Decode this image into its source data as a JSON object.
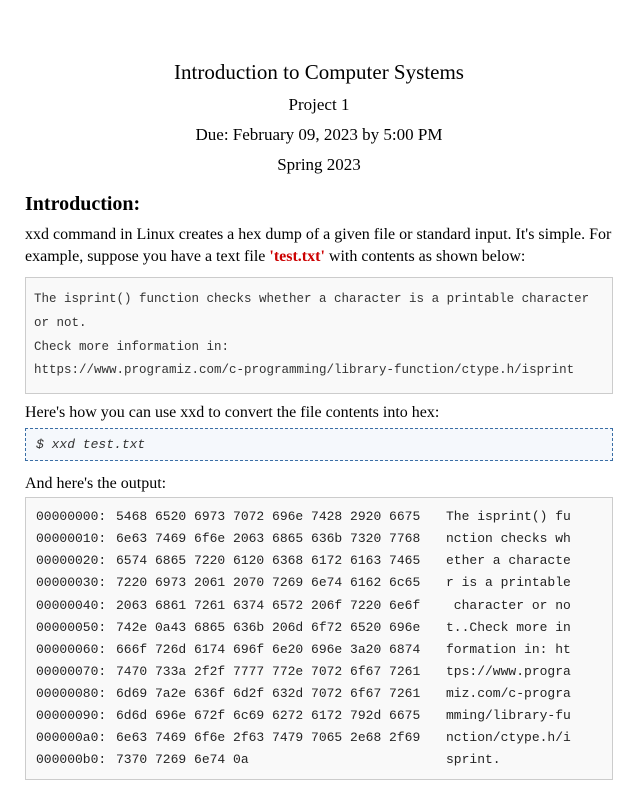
{
  "header": {
    "course_title": "Introduction to Computer Systems",
    "project_title": "Project 1",
    "due_date": "Due: February 09, 2023 by 5:00 PM",
    "semester": "Spring 2023"
  },
  "sections": {
    "intro_heading": "Introduction:",
    "intro_para_prefix": "xxd command in Linux creates  a hex dump of a given file or standard input. It's simple. For example, suppose you have a text file ",
    "intro_filename": "'test.txt'",
    "intro_para_suffix": " with contents as shown below:",
    "file_contents": "The isprint() function checks whether a character is a printable character or not.\nCheck more information in:\nhttps://www.programiz.com/c-programming/library-function/ctype.h/isprint",
    "convert_text": "Here's how you can use xxd to convert the file contents into hex:",
    "command": "$ xxd test.txt",
    "output_label": "And here's the output:",
    "output_rows": [
      {
        "addr": "00000000:",
        "hex": "5468 6520 6973 7072 696e 7428 2920 6675",
        "ascii": "The isprint() fu"
      },
      {
        "addr": "00000010:",
        "hex": "6e63 7469 6f6e 2063 6865 636b 7320 7768",
        "ascii": "nction checks wh"
      },
      {
        "addr": "00000020:",
        "hex": "6574 6865 7220 6120 6368 6172 6163 7465",
        "ascii": "ether a characte"
      },
      {
        "addr": "00000030:",
        "hex": "7220 6973 2061 2070 7269 6e74 6162 6c65",
        "ascii": "r is a printable"
      },
      {
        "addr": "00000040:",
        "hex": "2063 6861 7261 6374 6572 206f 7220 6e6f",
        "ascii": " character or no"
      },
      {
        "addr": "00000050:",
        "hex": "742e 0a43 6865 636b 206d 6f72 6520 696e",
        "ascii": "t..Check more in"
      },
      {
        "addr": "00000060:",
        "hex": "666f 726d 6174 696f 6e20 696e 3a20 6874",
        "ascii": "formation in: ht"
      },
      {
        "addr": "00000070:",
        "hex": "7470 733a 2f2f 7777 772e 7072 6f67 7261",
        "ascii": "tps://www.progra"
      },
      {
        "addr": "00000080:",
        "hex": "6d69 7a2e 636f 6d2f 632d 7072 6f67 7261",
        "ascii": "miz.com/c-progra"
      },
      {
        "addr": "00000090:",
        "hex": "6d6d 696e 672f 6c69 6272 6172 792d 6675",
        "ascii": "mming/library-fu"
      },
      {
        "addr": "000000a0:",
        "hex": "6e63 7469 6f6e 2f63 7479 7065 2e68 2f69",
        "ascii": "nction/ctype.h/i"
      },
      {
        "addr": "000000b0:",
        "hex": "7370 7269 6e74 0a",
        "ascii": "sprint."
      }
    ]
  }
}
